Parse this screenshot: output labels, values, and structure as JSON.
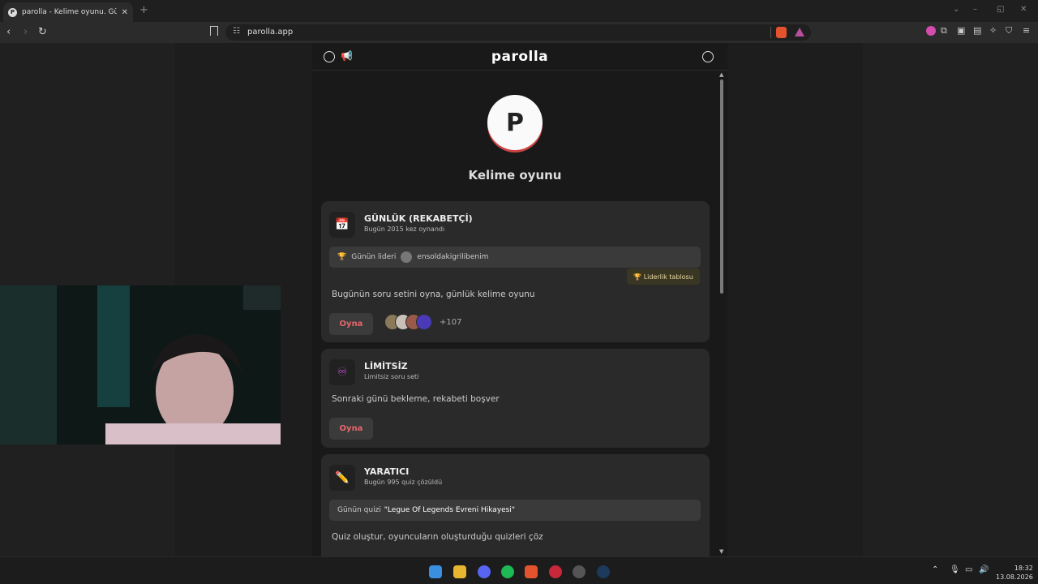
{
  "browser": {
    "tab_title": "parolla - Kelime oyunu. Günlük k",
    "tab_close": "✕",
    "new_tab": "+",
    "url": "parolla.app",
    "icons": [
      "back-icon",
      "forward-icon",
      "reload-icon",
      "bookmark-icon",
      "site-info-icon",
      "brave-shield-icon",
      "brave-rewards-icon",
      "extensions-icon",
      "sidebar-icon",
      "wallet-icon",
      "leo-icon",
      "vpn-icon",
      "menu-icon"
    ]
  },
  "app": {
    "brand": "parolla",
    "logo_letter": "P",
    "subtitle": "Kelime oyunu",
    "header_icons": [
      "globe-settings-icon",
      "megaphone-icon",
      "user-icon"
    ]
  },
  "cards": [
    {
      "icon": "📅",
      "title": "GÜNLÜK (REKABETÇİ)",
      "sub": "Bugün 2015 kez oynandı",
      "leader_label": "Günün lideri",
      "leader_name": "ensoldakigrilibenim",
      "leaderboard": "🏆 Liderlik tablosu",
      "desc": "Bugünün soru setini oyna, günlük kelime oyunu",
      "play": "Oyna",
      "players_more": "+107"
    },
    {
      "icon": "♾",
      "title": "LİMİTSİZ",
      "sub": "Limitsiz soru seti",
      "desc": "Sonraki günü bekleme, rekabeti boşver",
      "play": "Oyna"
    },
    {
      "icon": "✏️",
      "title": "YARATICI",
      "sub": "Bugün 995 quiz çözüldü",
      "quiz_label": "Günün quizi",
      "quiz_name": "\"Legue Of Legends Evreni Hikayesi\"",
      "desc": "Quiz oluştur, oyuncuların oluşturduğu quizleri çöz"
    }
  ],
  "taskbar": {
    "time": "18:32",
    "date": "13.08.2026",
    "apps": [
      "windows-start-icon",
      "file-explorer-icon",
      "discord-icon",
      "spotify-icon",
      "brave-icon",
      "app-red-icon",
      "app-chrome-like-icon",
      "steam-icon"
    ]
  },
  "colors": {
    "accent": "#e5676b",
    "card": "#2a2a2a",
    "background": "#191919"
  }
}
